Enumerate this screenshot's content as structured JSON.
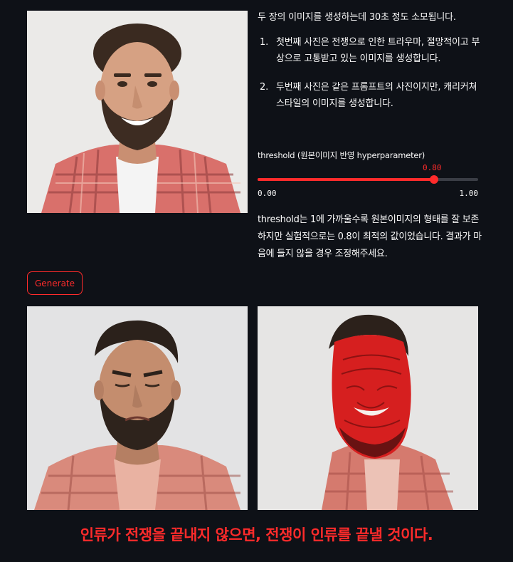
{
  "app": {
    "intro": "두 장의 이미지를 생성하는데 30초 정도 소모됩니다.",
    "steps": [
      {
        "num": "1.",
        "text": "첫번째 사진은 전쟁으로 인한 트라우마, 절망적이고 부상으로 고통받고 있는 이미지를 생성합니다."
      },
      {
        "num": "2.",
        "text": "두번째 사진은 같은 프롬프트의 사진이지만, 캐리커쳐 스타일의 이미지를 생성합니다."
      }
    ],
    "slider": {
      "label": "threshold (원본이미지 반영 hyperparameter)",
      "value_text": "0.80",
      "value": 0.8,
      "min_text": "0.00",
      "max_text": "1.00"
    },
    "note": "threshold는 1에 가까울수록 원본이미지의 형태를 잘 보존하지만 실험적으로는 0.8이 최적의 값이었습니다. 결과가 마음에 들지 않을 경우 조정해주세요.",
    "generate_label": "Generate",
    "slogan": "인류가 전쟁을 끝내지 않으면, 전쟁이 인류를 끝낼 것이다.",
    "colors": {
      "background": "#0e1117",
      "accent": "#ff2b2b",
      "text": "#fafafa"
    },
    "images": {
      "top": "original-portrait-smiling-man",
      "bottom_left": "generated-distressed-man",
      "bottom_right": "generated-caricature-red-face"
    }
  }
}
